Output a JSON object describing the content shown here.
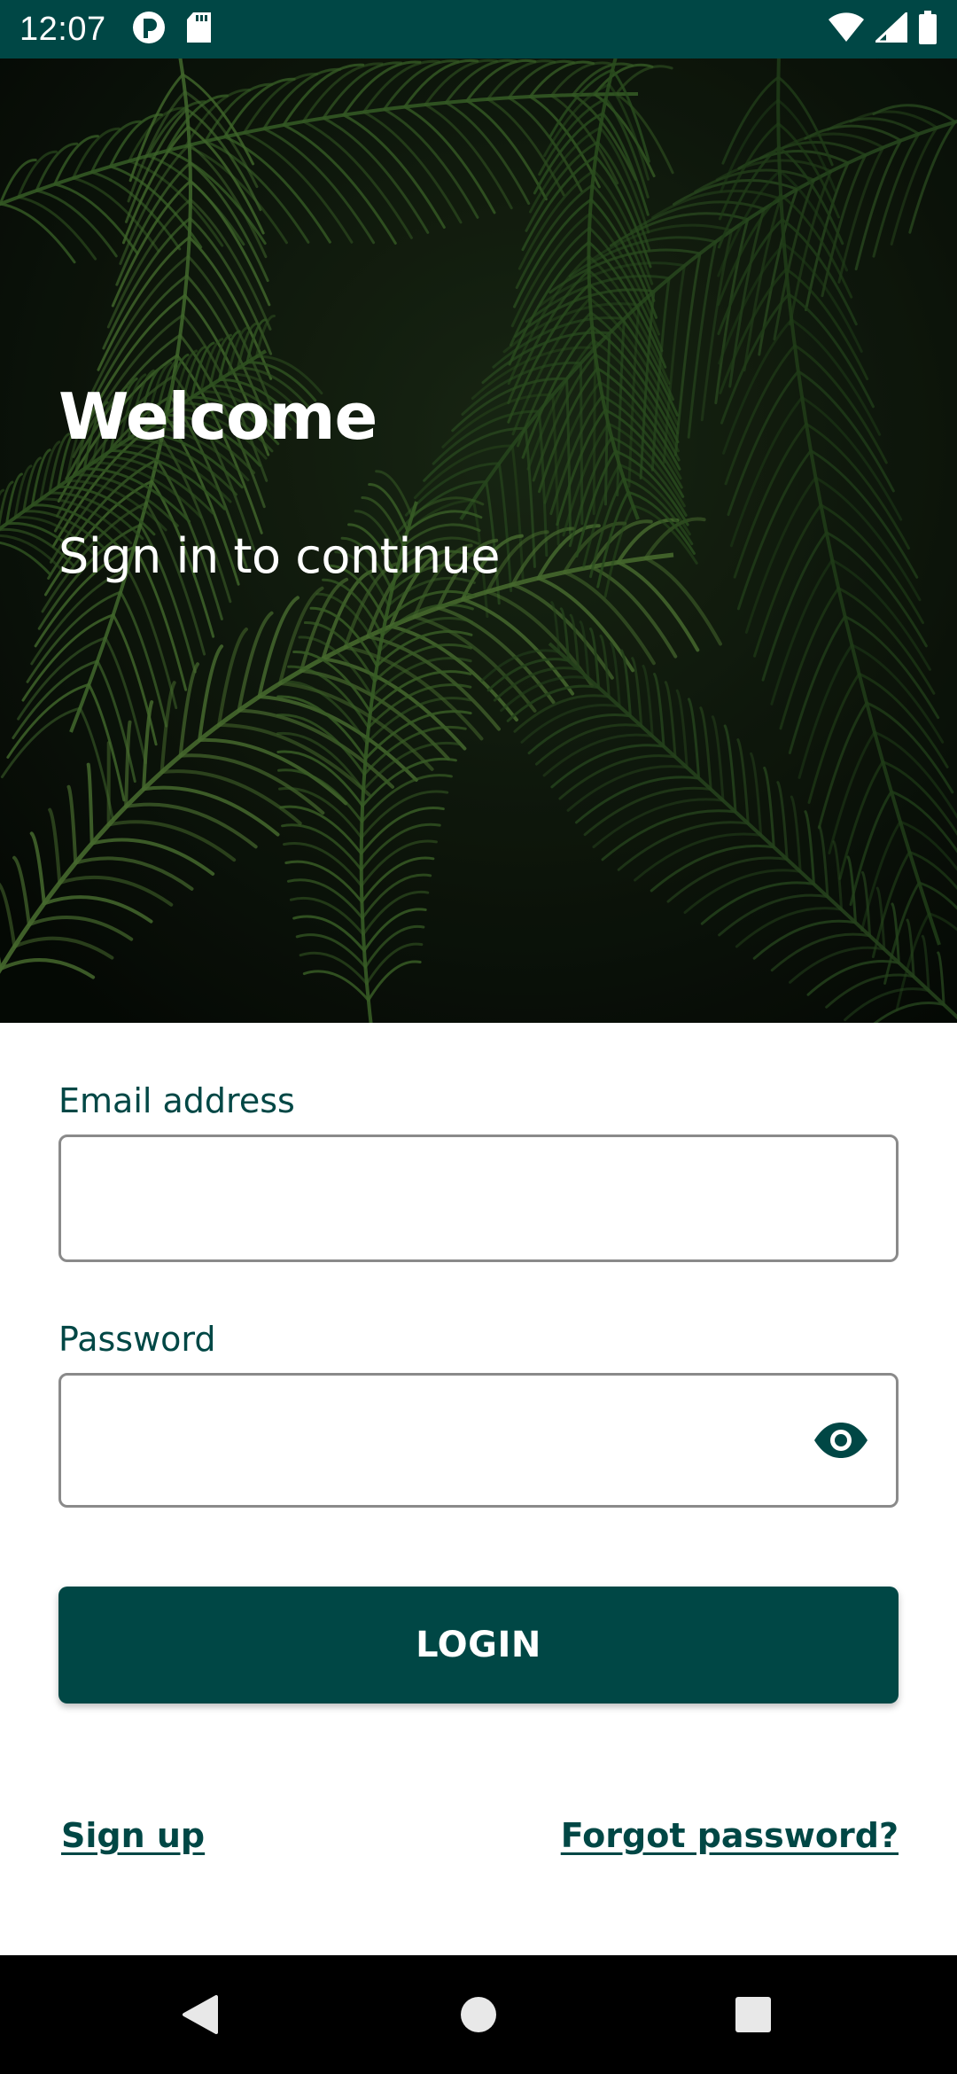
{
  "status_bar": {
    "time": "12:07",
    "left_icons": [
      "app-indicator-icon",
      "sd-card-icon"
    ],
    "right_icons": [
      "wifi-icon",
      "cell-signal-icon",
      "battery-icon"
    ]
  },
  "hero": {
    "title": "Welcome",
    "subtitle": "Sign in to continue",
    "background": "palm-foliage-photo"
  },
  "form": {
    "email_label": "Email address",
    "email_value": "",
    "password_label": "Password",
    "password_value": "",
    "password_toggle_icon": "eye-icon",
    "login_label": "LOGIN",
    "signup_link": "Sign up",
    "forgot_link": "Forgot password?"
  },
  "nav_bar": {
    "buttons": [
      "back-icon",
      "home-icon",
      "recents-icon"
    ]
  },
  "colors": {
    "primary": "#004745",
    "field_border": "#8a8a8a",
    "background": "#ffffff",
    "nav_bar": "#000000"
  }
}
